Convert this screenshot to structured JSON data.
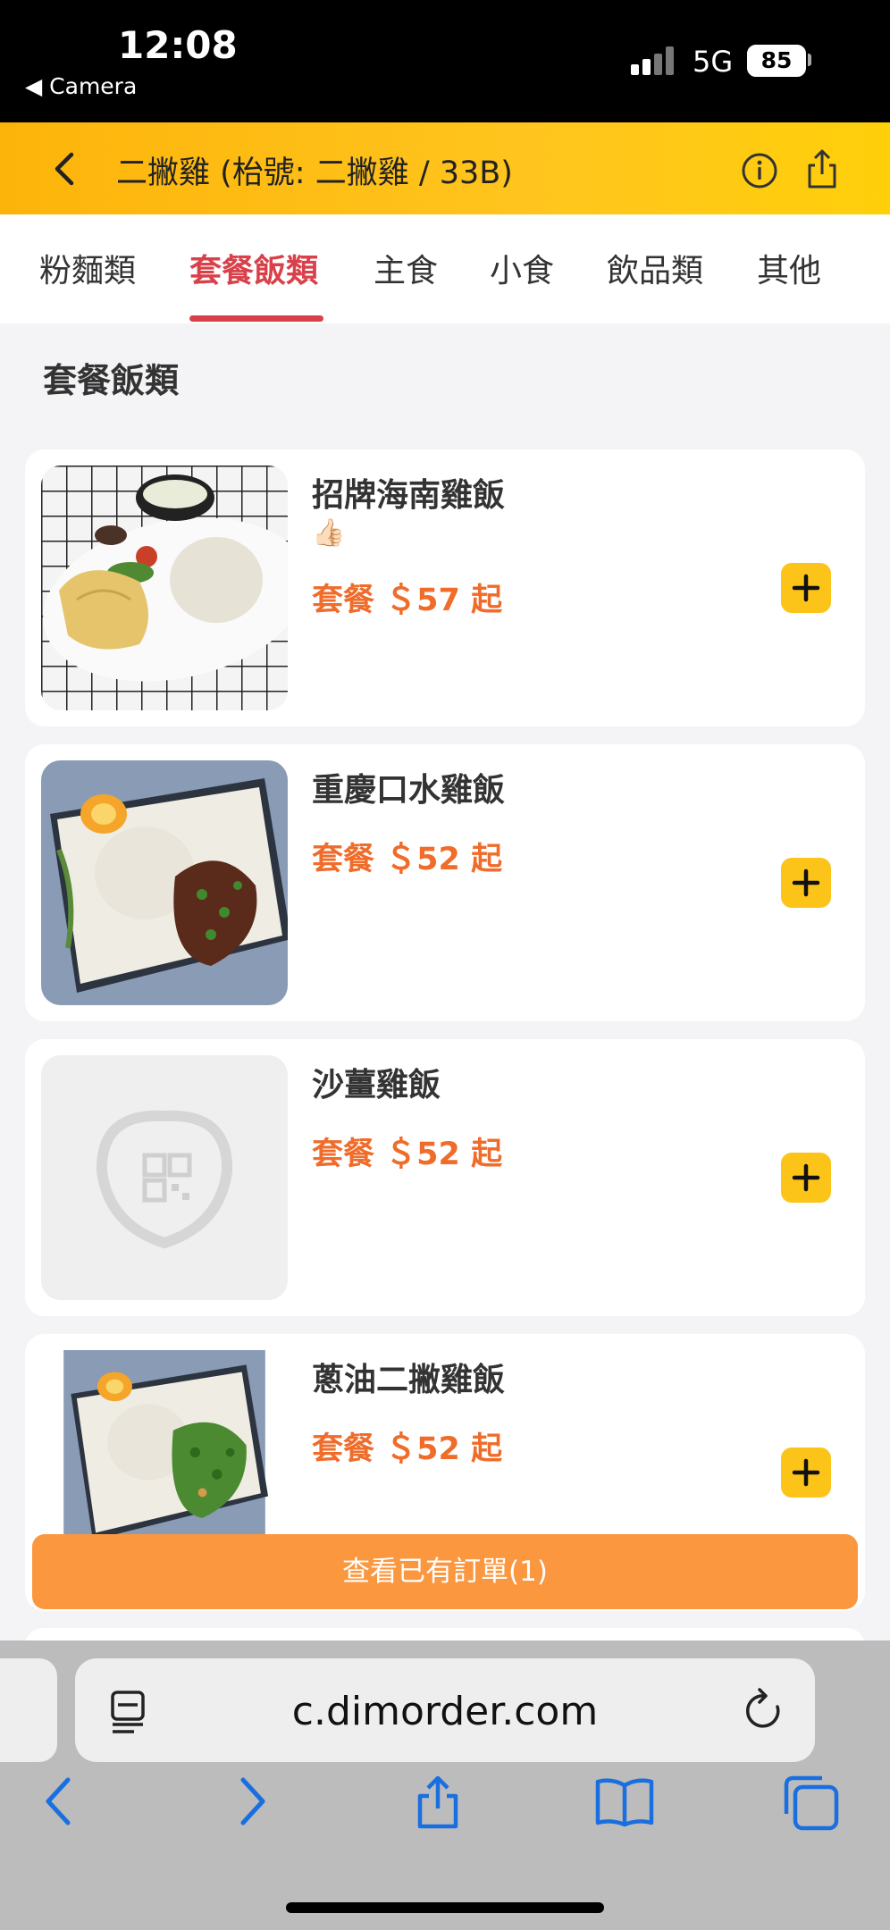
{
  "status_bar": {
    "time": "12:08",
    "back_app": "◀ Camera",
    "network": "5G",
    "battery": "85"
  },
  "header": {
    "title": "二撇雞 (枱號: 二撇雞 / 33B)"
  },
  "tabs": [
    {
      "label": "粉麵類"
    },
    {
      "label": "套餐飯類"
    },
    {
      "label": "主食"
    },
    {
      "label": "小食"
    },
    {
      "label": "飲品類"
    },
    {
      "label": "其他"
    }
  ],
  "section": {
    "title": "套餐飯類"
  },
  "items": [
    {
      "name": "招牌海南雞飯",
      "emoji": "👍🏻",
      "price": "套餐 ＄57 起"
    },
    {
      "name": "重慶口水雞飯",
      "price": "套餐 ＄52 起"
    },
    {
      "name": "沙薑雞飯",
      "price": "套餐 ＄52 起"
    },
    {
      "name": "蔥油二撇雞飯",
      "price": "套餐 ＄52 起"
    }
  ],
  "order_bar": {
    "label": "查看已有訂單(1)"
  },
  "browser": {
    "url": "c.dimorder.com"
  },
  "colors": {
    "accent": "#fcc319",
    "active_tab": "#d8414a",
    "price": "#ef6c2a",
    "order_bar": "#fb973f"
  },
  "icons": [
    "back-chevron-icon",
    "info-icon",
    "share-icon",
    "plus-icon",
    "reader-icon",
    "reload-icon",
    "browser-back-icon",
    "browser-forward-icon",
    "bookmarks-icon",
    "tabs-icon"
  ]
}
